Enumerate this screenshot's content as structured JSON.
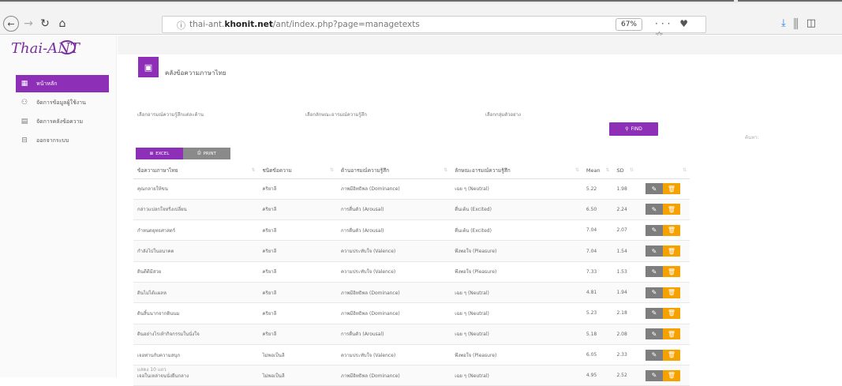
{
  "browser": {
    "url_prefix": "thai-ant.",
    "url_domain": "khonit.net",
    "url_path": "/ant/index.php?page=managetexts",
    "zoom": "67%",
    "page_actions": "··· ♥ ☆",
    "right_tools": "⤓ ⫼ ◫"
  },
  "sidebar": {
    "logo": "Thai-ANT",
    "items": [
      {
        "label": "หน้าหลัก",
        "icon": "dashboard-icon"
      },
      {
        "label": "จัดการข้อมูลผู้ใช้งาน",
        "icon": "users-icon"
      },
      {
        "label": "จัดการคลังข้อความ",
        "icon": "grid-icon"
      },
      {
        "label": "ออกจากระบบ",
        "icon": "logout-icon"
      }
    ]
  },
  "page": {
    "title": "คลังข้อความภาษาไทย",
    "filters": [
      "เลือกอารมณ์ความรู้สึกแต่ละด้าน",
      "เลือกลักษณะอารมณ์ความรู้สึก",
      "เลือกกลุ่มตัวอย่าง"
    ],
    "find_label": "FIND",
    "excel_label": "EXCEL",
    "print_label": "PRINT",
    "search_label": "ค้นหา:",
    "footer": "แสดง 10 แถว"
  },
  "table": {
    "headers": [
      "ข้อความภาษาไทย",
      "ชนิดข้อความ",
      "ด้านอารมณ์ความรู้สึก",
      "ลักษณะอารมณ์ความรู้สึก",
      "Mean",
      "SD",
      ""
    ],
    "rows": [
      [
        "คุณกลายให้ขน",
        "คริยาลี",
        "ภาพมีอิทธิพล (Dominance)",
        "เฉย ๆ (Neutral)",
        "5.22",
        "1.98"
      ],
      [
        "กล่าวแปลกใจหริ่งเปลี่ยน",
        "คริยาลี",
        "การตื่นตัว (Arousal)",
        "ตื่นเต้น (Excited)",
        "6.50",
        "2.24"
      ],
      [
        "กำหนดยุทธศาสตร์",
        "คริยาลี",
        "การตื่นตัว (Arousal)",
        "ตื่นเต้น (Excited)",
        "7.04",
        "2.07"
      ],
      [
        "กำลังไปในอนาคต",
        "คริยาลี",
        "ความประทับใจ (Valence)",
        "พึงพอใจ (Pleasure)",
        "7.04",
        "1.54"
      ],
      [
        "ดินดีดีมีสวย",
        "คริยาลี",
        "ความประทับใจ (Valence)",
        "พึงพอใจ (Pleasure)",
        "7.33",
        "1.53"
      ],
      [
        "ดินไม่ได้แผลห",
        "คริยาลี",
        "ภาพมีอิทธิพล (Dominance)",
        "เฉย ๆ (Neutral)",
        "4.81",
        "1.94"
      ],
      [
        "ดินสิ้นนากจากดินนม",
        "คริยาลี",
        "ภาพมีอิทธิพล (Dominance)",
        "เฉย ๆ (Neutral)",
        "5.23",
        "2.18"
      ],
      [
        "ดินอย่างไรเท้ากิจกรรมในนั่งใจ",
        "คริยาลี",
        "การตื่นตัว (Arousal)",
        "เฉย ๆ (Neutral)",
        "5.18",
        "2.08"
      ],
      [
        "เจอท่านกับความสนุก",
        "ไม่พอเป็นลี",
        "ความประทับใจ (Valence)",
        "พึงพอใจ (Pleasure)",
        "6.05",
        "2.33"
      ],
      [
        "เจอในเหล่าจนนั่งยืนกลาง",
        "ไม่พอเป็นลี",
        "ภาพมีอิทธิพล (Dominance)",
        "เฉย ๆ (Neutral)",
        "4.95",
        "2.52"
      ]
    ]
  }
}
